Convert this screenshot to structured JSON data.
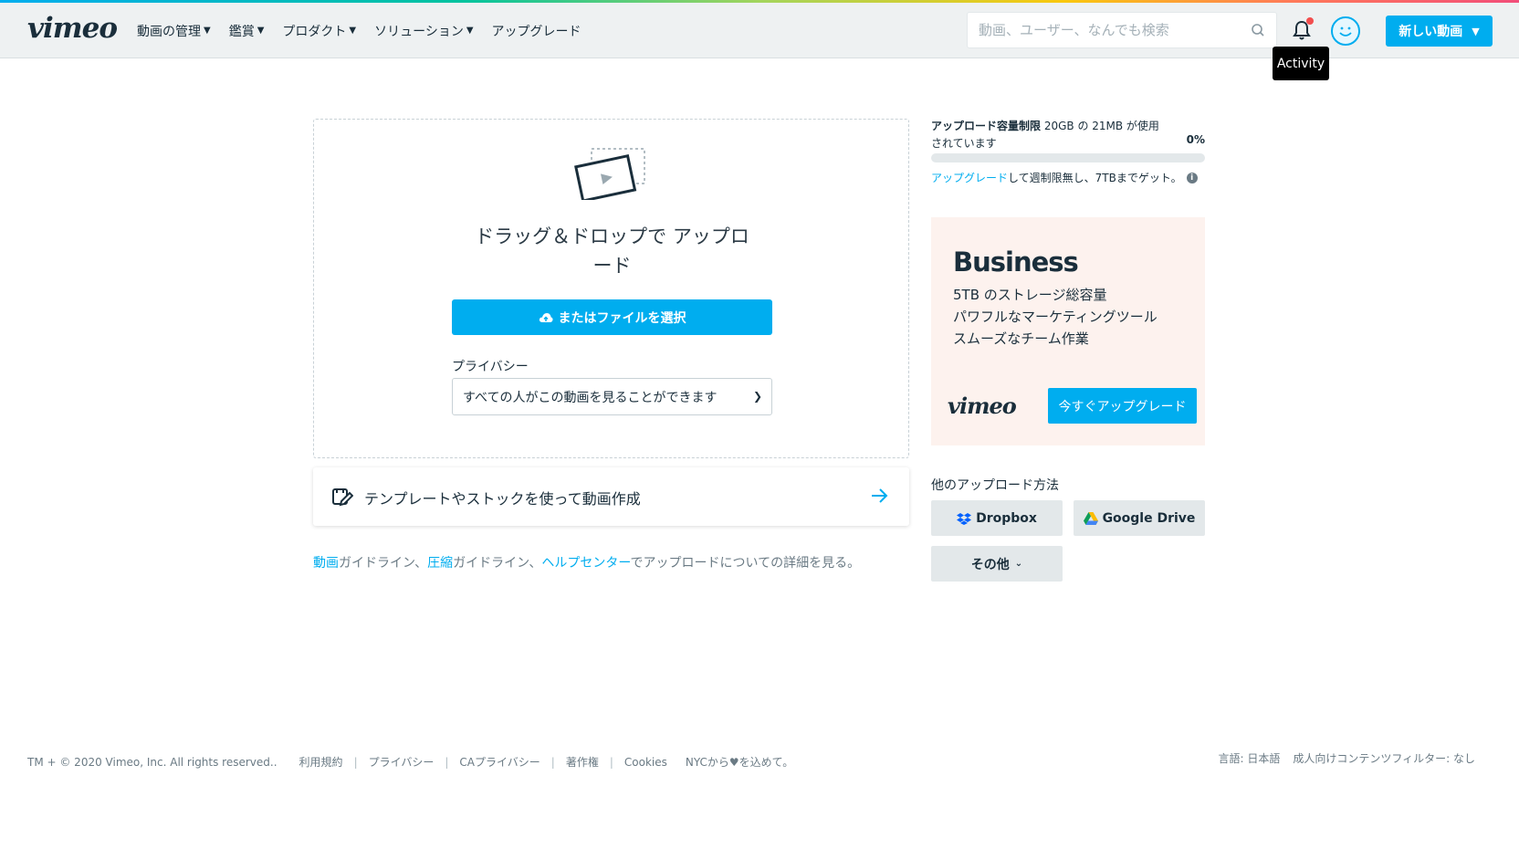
{
  "header": {
    "logo": "vimeo",
    "nav": [
      "動画の管理",
      "鑑賞",
      "プロダクト",
      "ソリューション",
      "アップグレード"
    ],
    "search_placeholder": "動画、ユーザー、なんでも検索",
    "tooltip": "Activity",
    "new_video": "新しい動画"
  },
  "upload": {
    "drop_text": "ドラッグ＆ドロップで アップロード",
    "file_button": "またはファイルを選択",
    "privacy_label": "プライバシー",
    "privacy_value": "すべての人がこの動画を見ることができます"
  },
  "template": {
    "text": "テンプレートやストックを使って動画作成"
  },
  "guide": {
    "link1": "動画",
    "t1": "ガイドライン、",
    "link2": "圧縮",
    "t2": "ガイドライン、",
    "link3": "ヘルプセンター",
    "t3": "でアップロードについての詳細を見る。"
  },
  "quota": {
    "label": "アップロード容量制限",
    "detail": " 20GB の 21MB が使用",
    "line2": "されています",
    "percent_text": "0%",
    "percent": 0,
    "upgrade_link": "アップグレード",
    "upgrade_text": "して週制限無し、7TBまでゲット。"
  },
  "business": {
    "title": "Business",
    "features": [
      "5TB のストレージ総容量",
      "パワフルなマーケティングツール",
      "スムーズなチーム作業"
    ],
    "logo": "vimeo",
    "button": "今すぐアップグレード"
  },
  "other_sources": {
    "label": "他のアップロード方法",
    "dropbox": "Dropbox",
    "gdrive": "Google Drive",
    "more": "その他"
  },
  "footer": {
    "copyright": "TM + © 2020 Vimeo, Inc. All rights reserved..",
    "links": [
      "利用規約",
      "プライバシー",
      "CAプライバシー",
      "著作権",
      "Cookies"
    ],
    "nyc_prefix": "NYCから",
    "nyc_suffix": "を込めて。",
    "language": "言語: 日本語",
    "filter": "成人向けコンテンツフィルター: なし"
  },
  "colors": {
    "accent": "#00adef",
    "text": "#1a2e3b",
    "header_bg": "#eef1f2",
    "business_bg": "#fdf2ee"
  }
}
